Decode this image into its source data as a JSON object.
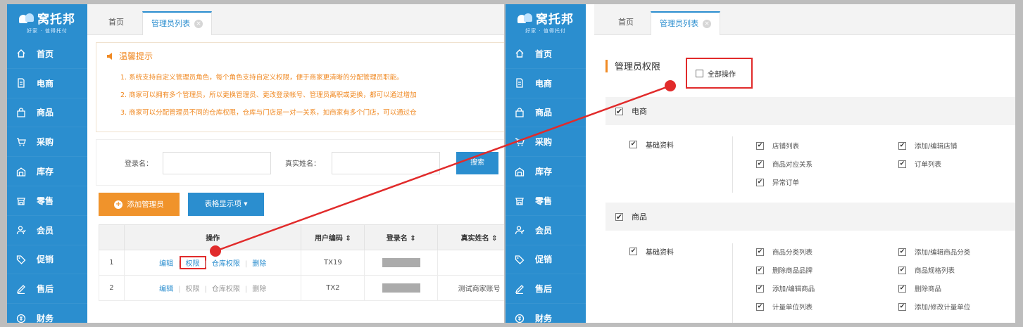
{
  "brand": {
    "name": "窝托邦",
    "slogan": "好家 · 值得托付"
  },
  "nav": [
    {
      "icon": "home-icon",
      "label": "首页"
    },
    {
      "icon": "document-icon",
      "label": "电商"
    },
    {
      "icon": "bag-icon",
      "label": "商品"
    },
    {
      "icon": "cart-icon",
      "label": "采购"
    },
    {
      "icon": "warehouse-icon",
      "label": "库存"
    },
    {
      "icon": "store-icon",
      "label": "零售"
    },
    {
      "icon": "member-icon",
      "label": "会员"
    },
    {
      "icon": "tag-icon",
      "label": "促销"
    },
    {
      "icon": "edit-icon",
      "label": "售后"
    },
    {
      "icon": "finance-icon",
      "label": "财务"
    }
  ],
  "tabs": {
    "home": "首页",
    "admin_list": "管理员列表",
    "close": "×"
  },
  "tips": {
    "title": "温馨提示",
    "lines": [
      "1. 系统支持自定义管理员角色，每个角色支持自定义权限，便于商家更清晰的分配管理员职能。",
      "2. 商家可以拥有多个管理员，所以更换管理员、更改登录帐号、管理员离职或更换，都可以通过增加",
      "3. 商家可以分配管理员不同的仓库权限，仓库与门店是一对一关系，如商家有多个门店，可以通过仓"
    ]
  },
  "search": {
    "login_label": "登录名：",
    "realname_label": "真实姓名：",
    "button": "搜索"
  },
  "actions": {
    "add": "添加管理员",
    "columns": "表格显示项 ▾",
    "add_icon": "+"
  },
  "table": {
    "headers": {
      "op": "操作",
      "code": "用户编码 ⇕",
      "login": "登录名 ⇕",
      "realname": "真实姓名 ⇕"
    },
    "ops": {
      "edit": "编辑",
      "perm": "权限",
      "wh_perm": "仓库权限",
      "delete": "删除"
    },
    "rows": [
      {
        "idx": "1",
        "code": "TX19",
        "realname": ""
      },
      {
        "idx": "2",
        "code": "TX2",
        "realname": "测试商家账号"
      }
    ]
  },
  "perm": {
    "title": "管理员权限",
    "all": "全部操作",
    "sections": [
      {
        "name": "电商",
        "group": "基础资料",
        "items": [
          "店铺列表",
          "添加/编辑店铺",
          "商品对应关系",
          "订单列表",
          "异常订单"
        ]
      },
      {
        "name": "商品",
        "group": "基础资料",
        "items": [
          "商品分类列表",
          "添加/编辑商品分类",
          "删除商品品牌",
          "商品规格列表",
          "添加/编辑商品",
          "删除商品",
          "计量单位列表",
          "添加/修改计量单位"
        ]
      }
    ]
  },
  "colors": {
    "sidebar": "#2b8ecf",
    "accent": "#f08a24",
    "highlight": "#e12b2b"
  }
}
